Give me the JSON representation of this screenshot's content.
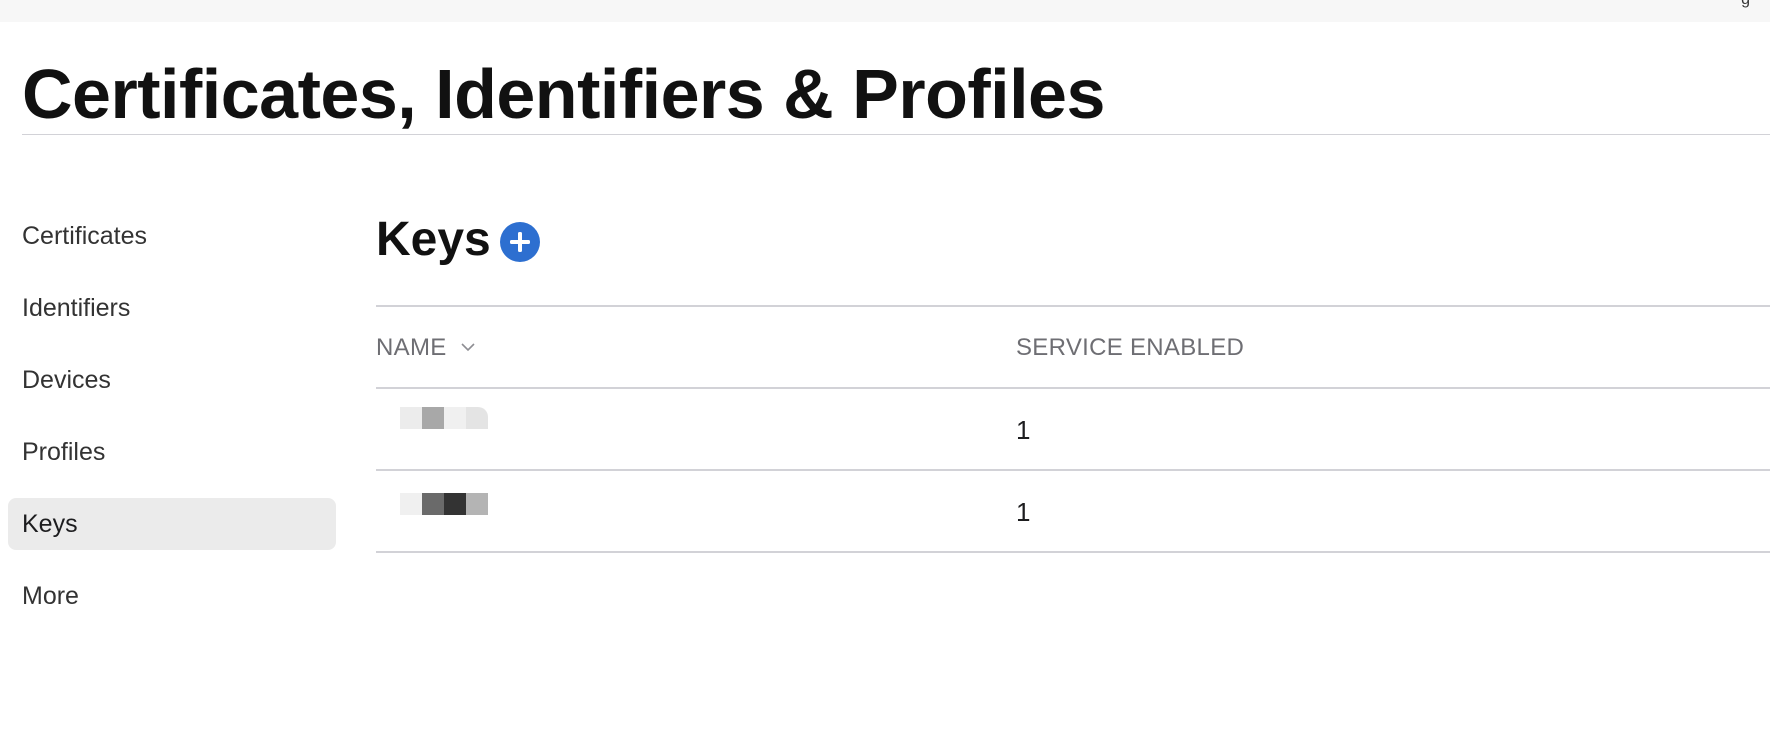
{
  "header": {
    "title": "Certificates, Identifiers & Profiles",
    "corner_glyph": "g"
  },
  "sidebar": {
    "items": [
      {
        "label": "Certificates",
        "active": false
      },
      {
        "label": "Identifiers",
        "active": false
      },
      {
        "label": "Devices",
        "active": false
      },
      {
        "label": "Profiles",
        "active": false
      },
      {
        "label": "Keys",
        "active": true
      },
      {
        "label": "More",
        "active": false
      }
    ]
  },
  "main": {
    "title": "Keys",
    "add_icon": "plus-circle-icon",
    "table": {
      "columns": {
        "name": "NAME",
        "service": "SERVICE ENABLED"
      },
      "sort_icon": "chevron-down-icon",
      "rows": [
        {
          "service_enabled": "1"
        },
        {
          "service_enabled": "1"
        }
      ]
    }
  },
  "colors": {
    "accent": "#2d6fd0",
    "active_bg": "#ebebeb",
    "divider": "#d2d2d7",
    "muted_text": "#6e6e73"
  }
}
